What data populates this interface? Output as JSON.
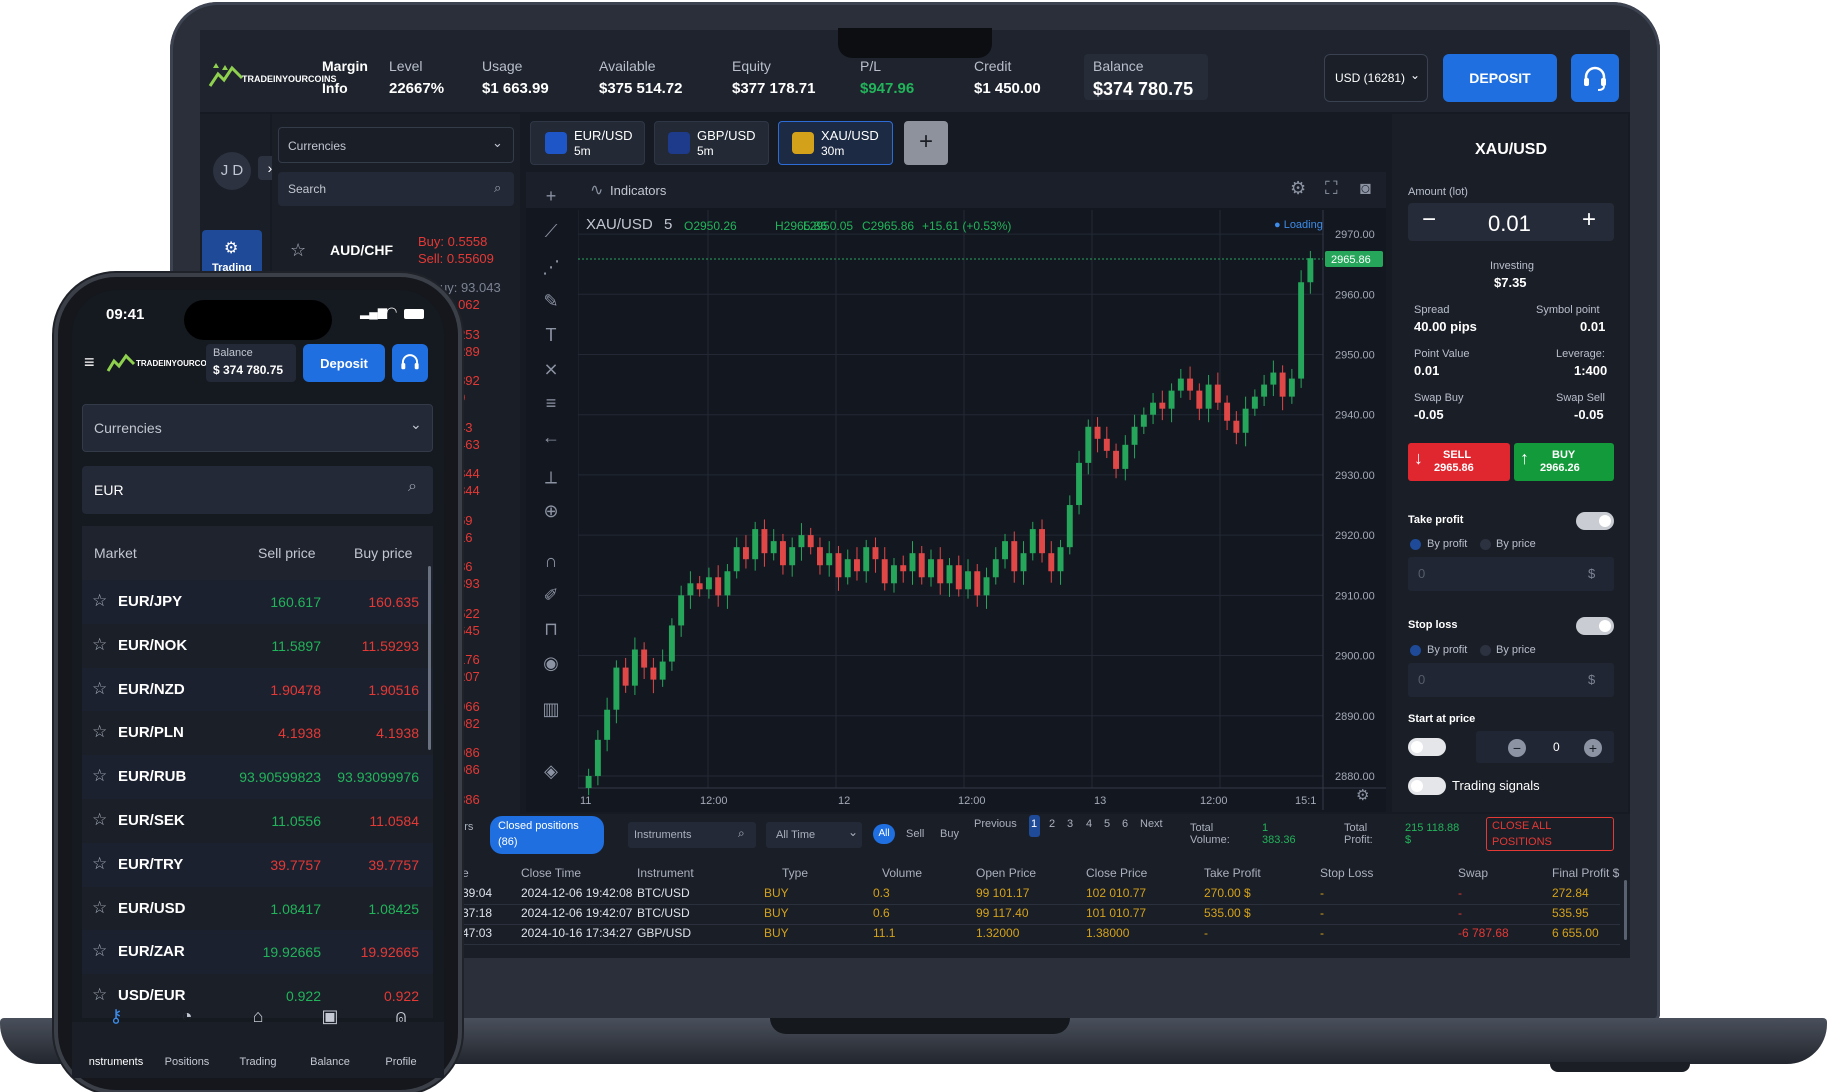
{
  "desktop": {
    "brand": "TRADEINYOURCOINS",
    "margin_info": {
      "label1": "Margin",
      "label2": "Info"
    },
    "stats": [
      {
        "label": "Level",
        "value": "22667%"
      },
      {
        "label": "Usage",
        "value": "$1 663.99"
      },
      {
        "label": "Available",
        "value": "$375 514.72"
      },
      {
        "label": "Equity",
        "value": "$377 178.71"
      },
      {
        "label": "P/L",
        "value": "$947.96"
      },
      {
        "label": "Credit",
        "value": "$1 450.00"
      }
    ],
    "balance": {
      "label": "Balance",
      "value": "$374 780.75"
    },
    "currency_select": "USD (16281)",
    "deposit": "DEPOSIT",
    "avatar": "J D",
    "sidebar_trading": "Trading",
    "category_select": "Currencies",
    "search_placeholder": "Search",
    "watch_first": {
      "symbol": "AUD/CHF",
      "buy": "Buy: 0.5558",
      "sell": "Sell: 0.55609"
    },
    "partial_prices": [
      {
        "a": "uy: 93.043",
        "b": "93.062",
        "ca": "#7c8393",
        "cb": "#e53935"
      },
      {
        "a": ".10253",
        "b": ".10289",
        "ca": "#e53935",
        "cb": "#e53935"
      },
      {
        "a": ".62892",
        "b": ".629",
        "ca": "#e53935",
        "cb": "#e53935"
      },
      {
        "a": ".6143",
        "b": ".61463",
        "ca": "#e53935",
        "cb": "#e53935"
      },
      {
        "a": "02.844",
        "b": "02.844",
        "ca": "#e53935",
        "cb": "#e53935"
      },
      {
        "a": "15.69",
        "b": "16.16",
        "ca": "#e53935",
        "cb": "#e53935"
      },
      {
        "a": "57.36",
        "b": "57.393",
        "ca": "#e53935",
        "cb": "#e53935"
      },
      {
        "a": ".72622",
        "b": ".72645",
        "ca": "#e53935",
        "cb": "#e53935"
      },
      {
        "a": ".56176",
        "b": ".56207",
        "ca": "#e53935",
        "cb": "#e53935"
      },
      {
        "a": ".95966",
        "b": ".95982",
        "ca": "#e53935",
        "cb": "#e53935"
      },
      {
        "a": ".45986",
        "b": ".45986",
        "ca": "#e53935",
        "cb": "#e53935"
      },
      {
        "a": "0.8386",
        "b": "",
        "ca": "#e53935",
        "cb": "#e53935"
      }
    ],
    "tabs": [
      {
        "pair": "EUR/USD",
        "tf": "5m",
        "active": false
      },
      {
        "pair": "GBP/USD",
        "tf": "5m",
        "active": false
      },
      {
        "pair": "XAU/USD",
        "tf": "30m",
        "active": true
      }
    ],
    "add_tab": "+",
    "indicators": "Indicators",
    "chart_header": {
      "symbol": "XAU/USD",
      "interval": "5",
      "o": "O2950.26",
      "h": "H2965.86",
      "l": "L2950.05",
      "c": "C2965.86",
      "change": "+15.61 (+0.53%)",
      "loading": "● Loading"
    },
    "last_price_tag": "2965.86",
    "time_labels": [
      "11",
      "12:00",
      "12",
      "12:00",
      "13",
      "12:00",
      "15:1"
    ],
    "order": {
      "symbol": "XAU/USD",
      "amount_label": "Amount (lot)",
      "amount": "0.01",
      "minus": "−",
      "plus": "+",
      "investing_label": "Investing",
      "investing": "$7.35",
      "spread_label": "Spread",
      "spread": "40.00 pips",
      "symbol_point_label": "Symbol point",
      "symbol_point": "0.01",
      "point_value_label": "Point Value",
      "point_value": "0.01",
      "leverage_label": "Leverage:",
      "leverage": "1:400",
      "swap_buy_label": "Swap Buy",
      "swap_buy": "-0.05",
      "swap_sell_label": "Swap Sell",
      "swap_sell": "-0.05",
      "sell_label": "SELL",
      "sell_price": "2965.86",
      "buy_label": "BUY",
      "buy_price": "2966.26",
      "take_profit": "Take profit",
      "stop_loss": "Stop loss",
      "by_profit": "By profit",
      "by_price": "By price",
      "zero": "0",
      "dollar": "$",
      "start_at_price": "Start at price",
      "stepper_value": "0",
      "stepper_minus": "−",
      "stepper_plus": "+",
      "trading_signals": "Trading signals"
    },
    "positions": {
      "orders_tab": "ders",
      "closed_tab": "Closed positions",
      "closed_count": "(86)",
      "instruments_placeholder": "Instruments",
      "period": "All Time",
      "filter_all": "All",
      "filter_sell": "Sell",
      "filter_buy": "Buy",
      "previous": "Previous",
      "pages": [
        "1",
        "2",
        "3",
        "4",
        "5",
        "6"
      ],
      "next": "Next",
      "total_volume_label1": "Total",
      "total_volume_label2": "Volume:",
      "total_volume_value1": "1",
      "total_volume_value2": "383.36",
      "total_profit_label1": "Total",
      "total_profit_label2": "Profit:",
      "total_profit_value1": "215 118.88",
      "total_profit_value2": "$",
      "close_all1": "CLOSE ALL",
      "close_all2": "POSITIONS",
      "columns": [
        "me",
        "Close Time",
        "Instrument",
        "Type",
        "Volume",
        "Open Price",
        "Close Price",
        "Take Profit",
        "Stop Loss",
        "Swap",
        "Final Profit $"
      ],
      "rows": [
        [
          "3:39:04",
          "2024-12-06 19:42:08",
          "BTC/USD",
          "BUY",
          "0.3",
          "99 101.17",
          "102 010.77",
          "270.00 $",
          "-",
          "-",
          "272.84"
        ],
        [
          "3:37:18",
          "2024-12-06 19:42:07",
          "BTC/USD",
          "BUY",
          "0.6",
          "99 117.40",
          "101 010.77",
          "535.00 $",
          "-",
          "-",
          "535.95"
        ],
        [
          "0:47:03",
          "2024-10-16 17:34:27",
          "GBP/USD",
          "BUY",
          "11.1",
          "1.32000",
          "1.38000",
          "-",
          "-",
          "-6 787.68",
          "6 655.00"
        ]
      ]
    }
  },
  "phone": {
    "time": "09:41",
    "brand": "TRADEINYOURCOINS",
    "balance_label": "Balance",
    "balance": "$ 374 780.75",
    "deposit": "Deposit",
    "category": "Currencies",
    "search_value": "EUR",
    "headers": {
      "market": "Market",
      "sell": "Sell price",
      "buy": "Buy price"
    },
    "rows": [
      {
        "symbol": "EUR/JPY",
        "sell": "160.617",
        "buy": "160.635",
        "sell_color": "#22b45a",
        "buy_color": "#e53935"
      },
      {
        "symbol": "EUR/NOK",
        "sell": "11.5897",
        "buy": "11.59293",
        "sell_color": "#22b45a",
        "buy_color": "#e53935"
      },
      {
        "symbol": "EUR/NZD",
        "sell": "1.90478",
        "buy": "1.90516",
        "sell_color": "#e53935",
        "buy_color": "#e53935"
      },
      {
        "symbol": "EUR/PLN",
        "sell": "4.1938",
        "buy": "4.1938",
        "sell_color": "#e53935",
        "buy_color": "#e53935"
      },
      {
        "symbol": "EUR/RUB",
        "sell": "93.90599823",
        "buy": "93.93099976",
        "sell_color": "#22b45a",
        "buy_color": "#22b45a"
      },
      {
        "symbol": "EUR/SEK",
        "sell": "11.0556",
        "buy": "11.0584",
        "sell_color": "#22b45a",
        "buy_color": "#e53935"
      },
      {
        "symbol": "EUR/TRY",
        "sell": "39.7757",
        "buy": "39.7757",
        "sell_color": "#e53935",
        "buy_color": "#e53935"
      },
      {
        "symbol": "EUR/USD",
        "sell": "1.08417",
        "buy": "1.08425",
        "sell_color": "#22b45a",
        "buy_color": "#22b45a"
      },
      {
        "symbol": "EUR/ZAR",
        "sell": "19.92665",
        "buy": "19.92665",
        "sell_color": "#22b45a",
        "buy_color": "#e53935"
      },
      {
        "symbol": "USD/EUR",
        "sell": "0.922",
        "buy": "0.922",
        "sell_color": "#22b45a",
        "buy_color": "#e53935"
      }
    ],
    "nav": [
      "nstruments",
      "Positions",
      "Trading",
      "Balance",
      "Profile"
    ]
  },
  "chart_data": {
    "type": "candlestick",
    "symbol": "XAU/USD",
    "y_ticks": [
      "2970.00",
      "2960.00",
      "2950.00",
      "2940.00",
      "2930.00",
      "2920.00",
      "2910.00",
      "2900.00",
      "2890.00",
      "2880.00"
    ],
    "ylim": [
      2878,
      2974
    ],
    "last_price": 2965.86,
    "close": [
      2880,
      2886,
      2891,
      2898,
      2895,
      2901,
      2898,
      2896,
      2899,
      2905,
      2910,
      2912,
      2911,
      2913,
      2910,
      2914,
      2918,
      2916,
      2921,
      2917,
      2919,
      2915,
      2918,
      2920,
      2918,
      2915,
      2917,
      2913,
      2916,
      2914,
      2918,
      2916,
      2912,
      2915,
      2914,
      2917,
      2913,
      2916,
      2912,
      2915,
      2911,
      2914,
      2910,
      2913,
      2916,
      2919,
      2914,
      2917,
      2921,
      2917,
      2914,
      2918,
      2925,
      2932,
      2938,
      2936,
      2934,
      2931,
      2935,
      2938,
      2940,
      2942,
      2941,
      2944,
      2946,
      2944,
      2941,
      2945,
      2942,
      2939,
      2937,
      2941,
      2943,
      2945,
      2947,
      2943,
      2946,
      2962,
      2966
    ]
  }
}
